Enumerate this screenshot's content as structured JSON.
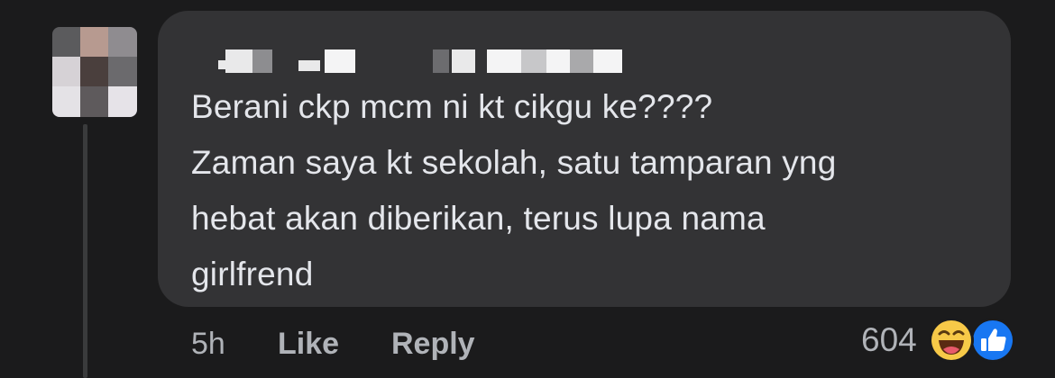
{
  "comment": {
    "author_redacted": true,
    "text_lines": [
      "Berani ckp mcm ni kt cikgu ke????",
      "Zaman saya kt sekolah, satu tamparan yng",
      "hebat akan diberikan, terus lupa nama",
      "girlfrend"
    ]
  },
  "actions": {
    "time": "5h",
    "like_label": "Like",
    "reply_label": "Reply"
  },
  "reactions": {
    "count": "604",
    "icons": [
      "haha-reaction-icon",
      "like-reaction-icon"
    ]
  },
  "colors": {
    "background": "#1b1b1c",
    "bubble": "#333335",
    "text": "#e4e6eb",
    "secondary": "#b0b3b8",
    "like_blue": "#1877f2",
    "haha_yellow": "#f7c948"
  }
}
